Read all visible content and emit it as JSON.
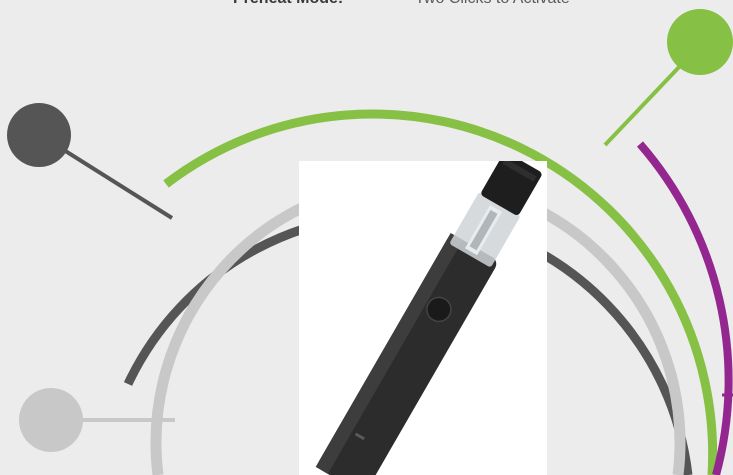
{
  "feature": {
    "label": "Preheat Mode:",
    "value": "Two Clicks to Activate"
  },
  "colors": {
    "background": "#ececec",
    "green_accent": "#86c044",
    "dark_gray": "#555555",
    "light_gray": "#c8c8c8",
    "purple_accent": "#93278f",
    "product_body": "#2c2c2c"
  },
  "icons": {
    "product": "vape-pen-device",
    "node_green": "green-circle-node",
    "node_dark": "dark-circle-node",
    "node_light": "light-circle-node"
  }
}
